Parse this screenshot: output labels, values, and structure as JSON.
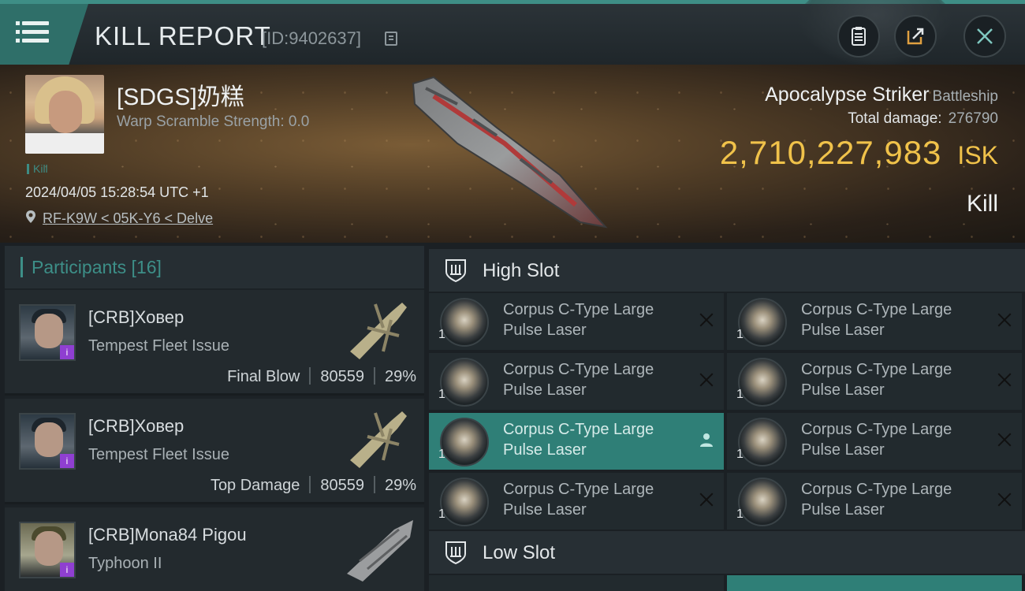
{
  "header": {
    "title": "KILL REPORT",
    "report_id": "[ID:9402637]"
  },
  "victim": {
    "name": "[SDGS]奶糕",
    "warp_scramble": "Warp Scramble Strength: 0.0",
    "tag": "Kill",
    "timestamp": "2024/04/05 15:28:54 UTC +1",
    "location": "RF-K9W < 05K-Y6 < Delve",
    "ship_name": "Apocalypse Striker",
    "ship_class": "Battleship",
    "total_damage_label": "Total damage:",
    "total_damage": "276790",
    "isk_value": "2,710,227,983",
    "isk_unit": "ISK",
    "result": "Kill"
  },
  "participants": {
    "title": "Participants [16]",
    "items": [
      {
        "name": "[CRB]Ховер",
        "ship": "Tempest Fleet Issue",
        "role": "Final Blow",
        "damage": "80559",
        "percent": "29%"
      },
      {
        "name": "[CRB]Ховер",
        "ship": "Tempest Fleet Issue",
        "role": "Top Damage",
        "damage": "80559",
        "percent": "29%"
      },
      {
        "name": "[CRB]Mona84 Pigou",
        "ship": "Typhoon II"
      }
    ]
  },
  "fitting": {
    "high_slot_label": "High Slot",
    "low_slot_label": "Low Slot",
    "high_slot": [
      {
        "line1": "Corpus C-Type Large",
        "line2": "Pulse Laser",
        "qty": "1"
      },
      {
        "line1": "Corpus C-Type Large",
        "line2": "Pulse Laser",
        "qty": "1"
      },
      {
        "line1": "Corpus C-Type Large",
        "line2": "Pulse Laser",
        "qty": "1"
      },
      {
        "line1": "Corpus C-Type Large",
        "line2": "Pulse Laser",
        "qty": "1"
      },
      {
        "line1": "Corpus C-Type Large",
        "line2": "Pulse Laser",
        "qty": "1"
      },
      {
        "line1": "Corpus C-Type Large",
        "line2": "Pulse Laser",
        "qty": "1"
      },
      {
        "line1": "Corpus C-Type Large",
        "line2": "Pulse Laser",
        "qty": "1"
      },
      {
        "line1": "Corpus C-Type Large",
        "line2": "Pulse Laser",
        "qty": "1"
      }
    ]
  },
  "icons": [
    "menu-icon",
    "copy-icon",
    "clipboard-icon",
    "share-icon",
    "close-icon",
    "location-pin-icon",
    "shield-icon",
    "remove-icon",
    "pilot-icon"
  ],
  "colors": {
    "accent": "#3d8f88",
    "isk": "#f0c24a",
    "active_module": "#2f7f77"
  }
}
